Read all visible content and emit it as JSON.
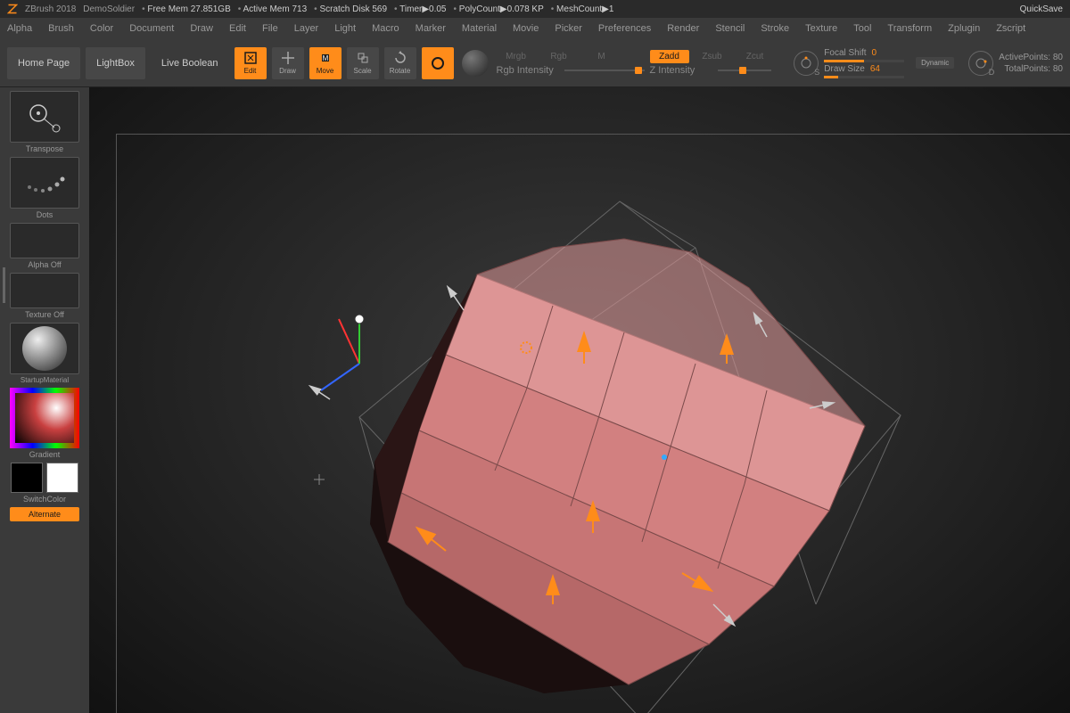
{
  "titlebar": {
    "app": "ZBrush 2018",
    "project": "DemoSoldier",
    "freemem": "Free Mem 27.851GB",
    "activemem": "Active Mem 713",
    "scratch": "Scratch Disk 569",
    "timer": "Timer▶0.05",
    "polycount": "PolyCount▶0.078 KP",
    "meshcount": "MeshCount▶1",
    "quicksave": "QuickSave"
  },
  "menus": [
    "Alpha",
    "Brush",
    "Color",
    "Document",
    "Draw",
    "Edit",
    "File",
    "Layer",
    "Light",
    "Macro",
    "Marker",
    "Material",
    "Movie",
    "Picker",
    "Preferences",
    "Render",
    "Stencil",
    "Stroke",
    "Texture",
    "Tool",
    "Transform",
    "Zplugin",
    "Zscript"
  ],
  "toolbar": {
    "home": "Home Page",
    "lightbox": "LightBox",
    "livebool": "Live Boolean",
    "modes": {
      "edit": "Edit",
      "draw": "Draw",
      "move": "Move",
      "scale": "Scale",
      "rotate": "Rotate",
      "gizmo": ""
    },
    "channels": {
      "mrgb": "Mrgb",
      "rgb": "Rgb",
      "m": "M",
      "zadd": "Zadd",
      "zsub": "Zsub",
      "zcut": "Zcut"
    },
    "rgb_intensity": "Rgb Intensity",
    "z_intensity": "Z Intensity",
    "focal_shift": "Focal Shift",
    "focal_val": "0",
    "draw_size": "Draw Size",
    "draw_val": "64",
    "dynamic": "Dynamic",
    "activepts": "ActivePoints: 80",
    "totalpts": "TotalPoints: 80"
  },
  "left": {
    "transpose": "Transpose",
    "dots": "Dots",
    "alpha": "Alpha Off",
    "texture": "Texture Off",
    "material": "StartupMaterial",
    "gradient": "Gradient",
    "switchcolor": "SwitchColor",
    "alternate": "Alternate"
  }
}
